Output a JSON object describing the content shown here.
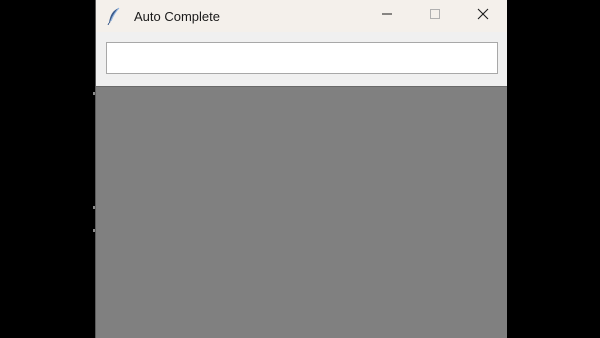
{
  "window": {
    "title": "Auto Complete",
    "app_icon": "feather-icon",
    "controls": {
      "minimize_icon": "minimize-icon",
      "maximize_icon": "maximize-icon",
      "close_icon": "close-icon"
    }
  },
  "entry": {
    "value": ""
  },
  "colors": {
    "titlebar": "#f4f0eb",
    "window_bg": "#f0f0f0",
    "listbox_bg": "#808080",
    "desktop": "#000000"
  }
}
